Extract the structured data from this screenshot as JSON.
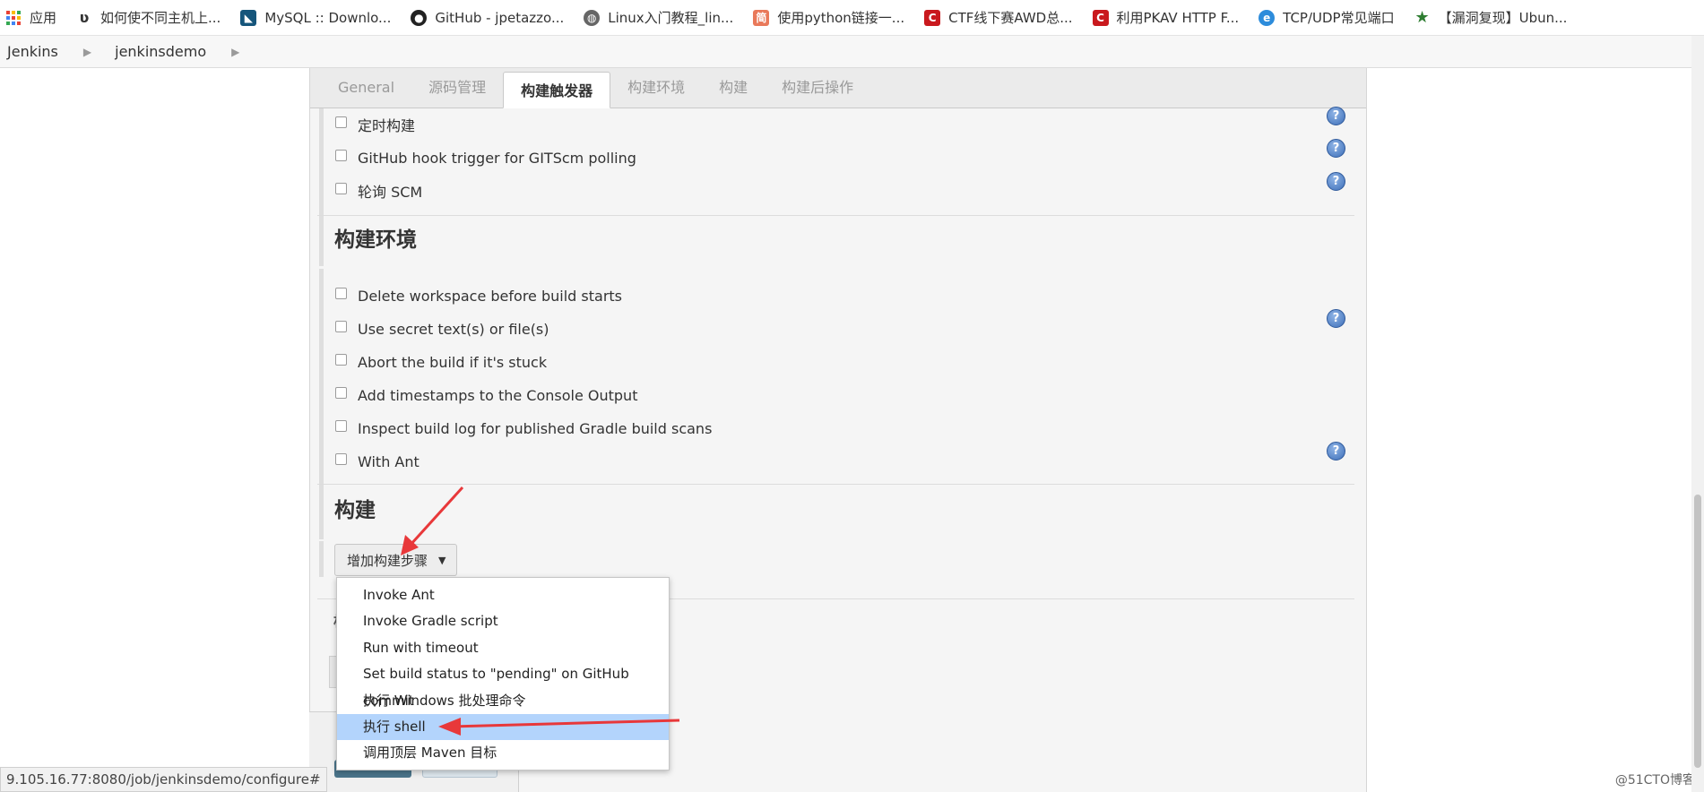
{
  "bookmarks": [
    {
      "label": "应用",
      "icon": "apps-grid-icon"
    },
    {
      "label": "如何使不同主机上...",
      "icon": "site-icon"
    },
    {
      "label": "MySQL :: Downlo...",
      "icon": "mysql-icon"
    },
    {
      "label": "GitHub - jpetazzo...",
      "icon": "github-icon"
    },
    {
      "label": "Linux入门教程_lin...",
      "icon": "globe-icon"
    },
    {
      "label": "使用python链接一...",
      "icon": "jianshu-icon"
    },
    {
      "label": "CTF线下赛AWD总...",
      "icon": "csdn-icon"
    },
    {
      "label": "利用PKAV HTTP F...",
      "icon": "csdn-icon"
    },
    {
      "label": "TCP/UDP常见端口",
      "icon": "edge-icon"
    },
    {
      "label": "【漏洞复现】Ubun...",
      "icon": "star-icon"
    }
  ],
  "breadcrumb": {
    "root": "Jenkins",
    "job": "jenkinsdemo"
  },
  "tabs": [
    "General",
    "源码管理",
    "构建触发器",
    "构建环境",
    "构建",
    "构建后操作"
  ],
  "active_tab": "构建触发器",
  "triggers": [
    {
      "label": "定时构建",
      "checked": false,
      "help": true
    },
    {
      "label": "GitHub hook trigger for GITScm polling",
      "checked": false,
      "help": true
    },
    {
      "label": "轮询 SCM",
      "checked": false,
      "help": true
    }
  ],
  "env_section": {
    "title": "构建环境",
    "options": [
      {
        "label": "Delete workspace before build starts",
        "help": false
      },
      {
        "label": "Use secret text(s) or file(s)",
        "help": true
      },
      {
        "label": "Abort the build if it's stuck",
        "help": false
      },
      {
        "label": "Add timestamps to the Console Output",
        "help": false
      },
      {
        "label": "Inspect build log for published Gradle build scans",
        "help": false
      },
      {
        "label": "With Ant",
        "help": true
      }
    ]
  },
  "build_section": {
    "title": "构建",
    "add_step_label": "增加构建步骤"
  },
  "post_section": {
    "title": "构"
  },
  "dropdown": {
    "items": [
      "Invoke Ant",
      "Invoke Gradle script",
      "Run with timeout",
      "Set build status to \"pending\" on GitHub commit",
      "执行 Windows 批处理命令",
      "执行 shell",
      "调用顶层 Maven 目标"
    ],
    "highlighted": "执行 shell"
  },
  "status_url": "9.105.16.77:8080/job/jenkinsdemo/configure#",
  "watermark": "@51CTO博客",
  "colors": {
    "arrow": "#e8383a",
    "menu_highlight": "#b3d4fc",
    "help_icon": "#3e6fb8"
  }
}
